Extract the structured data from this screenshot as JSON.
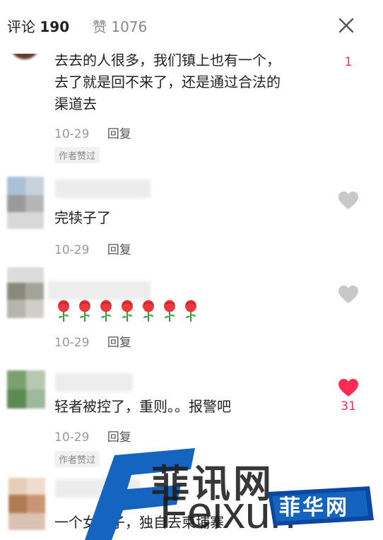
{
  "header": {
    "comments_label": "评论",
    "comments_count": "190",
    "likes_label": "赞",
    "likes_count": "1076",
    "close_icon": "close-icon"
  },
  "comments": [
    {
      "text_lines": [
        "去去的人很多，我们镇上也有一个，",
        "去了就是回不来了，还是通过合法的",
        "渠道去"
      ],
      "date": "10-29",
      "reply_label": "回复",
      "badge": "作者赞过",
      "like_count": "1",
      "liked": false
    },
    {
      "text": "完犊子了",
      "date": "10-29",
      "reply_label": "回复",
      "like_count": "",
      "liked": false
    },
    {
      "text": "",
      "emoji": "rose-emoji",
      "emoji_count": 7,
      "date": "10-29",
      "reply_label": "回复",
      "like_count": "",
      "liked": false
    },
    {
      "text": "轻者被控了，重则。。报警吧",
      "date": "10-29",
      "reply_label": "回复",
      "badge": "作者赞过",
      "like_count": "31",
      "liked": true
    },
    {
      "text": "一个女孩子，独自去柬埔寨",
      "date": "",
      "reply_label": "",
      "like_count": "",
      "liked": false
    }
  ],
  "watermark": {
    "cn": "菲讯网",
    "en": "Feixun",
    "badge": "菲华网"
  },
  "colors": {
    "liked_heart": "#fe2c55",
    "unliked_heart": "#c8c8c8",
    "watermark_blue": "#1565c0"
  }
}
